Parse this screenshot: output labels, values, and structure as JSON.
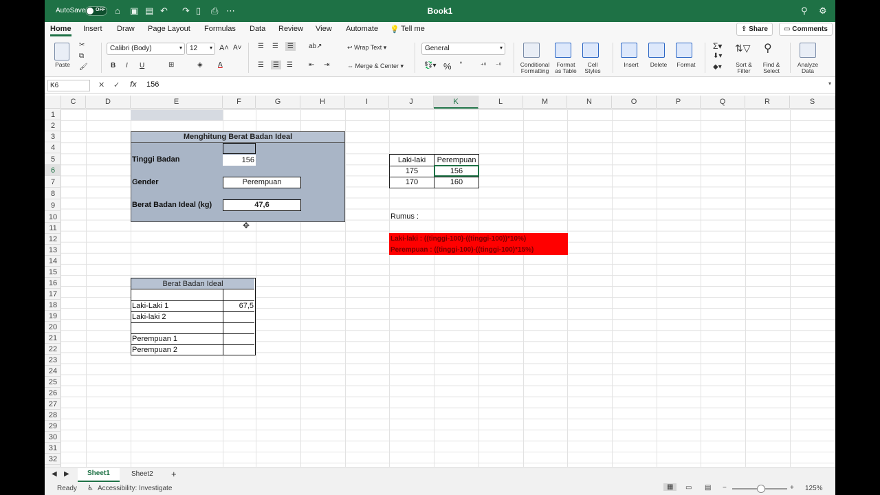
{
  "titlebar": {
    "autosave_label": "AutoSave",
    "autosave_state": "OFF",
    "doc_title": "Book1"
  },
  "menu": {
    "tabs": [
      "Home",
      "Insert",
      "Draw",
      "Page Layout",
      "Formulas",
      "Data",
      "Review",
      "View",
      "Automate"
    ],
    "tell_me": "Tell me",
    "share": "Share",
    "comments": "Comments"
  },
  "ribbon": {
    "paste": "Paste",
    "font_name": "Calibri (Body)",
    "font_size": "12",
    "bold": "B",
    "italic": "I",
    "underline": "U",
    "wrap_text": "Wrap Text",
    "merge_center": "Merge & Center",
    "number_format": "General",
    "percent": "%",
    "conditional_formatting": [
      "Conditional",
      "Formatting"
    ],
    "format_as_table": [
      "Format",
      "as Table"
    ],
    "cell_styles": [
      "Cell",
      "Styles"
    ],
    "insert": "Insert",
    "delete": "Delete",
    "format": "Format",
    "sort_filter": [
      "Sort &",
      "Filter"
    ],
    "find_select": [
      "Find &",
      "Select"
    ],
    "analyze_data": [
      "Analyze",
      "Data"
    ]
  },
  "formula_bar": {
    "name_box": "K6",
    "fx": "fx",
    "value": "156"
  },
  "columns": [
    "C",
    "D",
    "E",
    "F",
    "G",
    "H",
    "I",
    "J",
    "K",
    "L",
    "M",
    "N",
    "O",
    "P",
    "Q",
    "R",
    "S"
  ],
  "rows": [
    "1",
    "2",
    "3",
    "4",
    "5",
    "6",
    "7",
    "8",
    "9",
    "10",
    "11",
    "12",
    "13",
    "14",
    "15",
    "16",
    "17",
    "18",
    "19",
    "20",
    "21",
    "22",
    "23",
    "24",
    "25",
    "26",
    "27",
    "28",
    "29",
    "30",
    "31",
    "32"
  ],
  "calculator": {
    "title": "Menghitung Berat Badan Ideal",
    "height_label": "Tinggi Badan",
    "height_value": "156",
    "gender_label": "Gender",
    "gender_value": "Perempuan",
    "result_label": "Berat Badan Ideal (kg)",
    "result_value": "47,6"
  },
  "lookup_table": {
    "headers": [
      "Laki-laki",
      "Perempuan"
    ],
    "rows": [
      [
        "175",
        "156"
      ],
      [
        "170",
        "160"
      ]
    ]
  },
  "formula_note": {
    "label": "Rumus :",
    "male": "Laki-laki : ((tinggi-100)-((tinggi-100))*10%)",
    "female": "Perempuan : ((tinggi-100)-((tinggi-100)*15%)"
  },
  "summary_table": {
    "title": "Berat Badan Ideal",
    "rows": [
      {
        "label": "",
        "value": ""
      },
      {
        "label": "Laki-Laki 1",
        "value": "67,5"
      },
      {
        "label": "Laki-laki 2",
        "value": ""
      },
      {
        "label": "",
        "value": ""
      },
      {
        "label": "Perempuan 1",
        "value": ""
      },
      {
        "label": "Perempuan 2",
        "value": ""
      }
    ]
  },
  "sheets": [
    "Sheet1",
    "Sheet2"
  ],
  "status": {
    "ready": "Ready",
    "accessibility": "Accessibility: Investigate",
    "zoom": "125%"
  },
  "colors": {
    "excel_green": "#1e7145",
    "block_fill": "#a9b5c6",
    "note_red": "#ff0000"
  }
}
